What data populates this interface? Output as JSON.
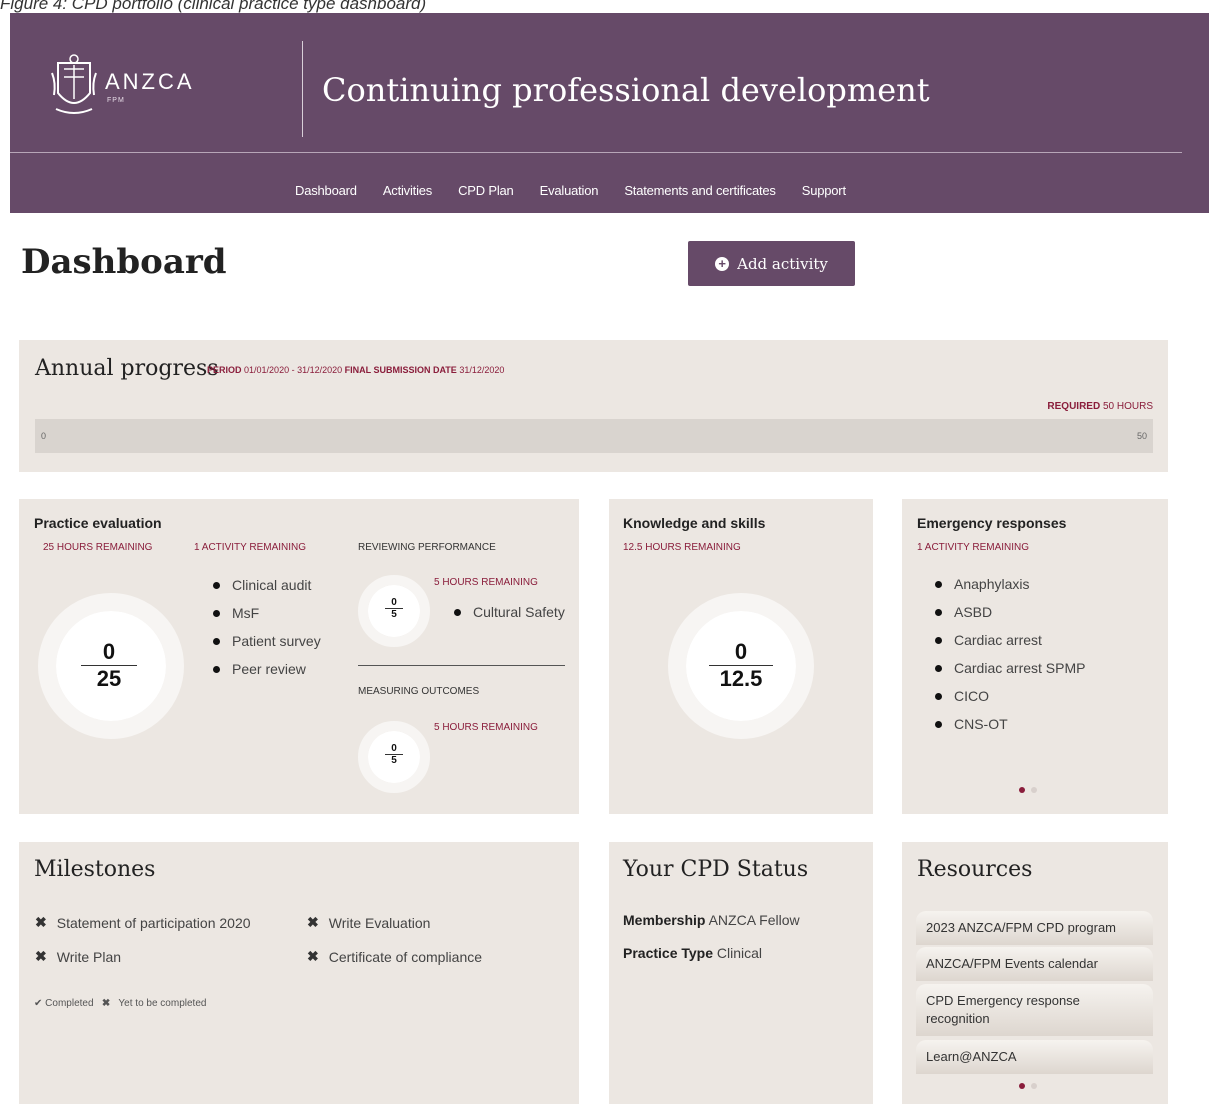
{
  "caption": "Figure 4: CPD portfolio (clinical practice type dashboard)",
  "header": {
    "logo_text": "ANZCA",
    "logo_sub": "FPM",
    "title": "Continuing professional development",
    "color": "#664a68"
  },
  "nav": [
    "Dashboard",
    "Activities",
    "CPD Plan",
    "Evaluation",
    "Statements and certificates",
    "Support"
  ],
  "page_title": "Dashboard",
  "add_button": "Add activity",
  "annual": {
    "title": "Annual progress",
    "period_label": "PERIOD",
    "period": "01/01/2020 - 31/12/2020",
    "submission_label": "FINAL SUBMISSION DATE",
    "submission_date": "31/12/2020",
    "required_label": "REQUIRED",
    "required_value": "50 HOURS",
    "bar_min": "0",
    "bar_max": "50",
    "progress_fraction": 0
  },
  "practice": {
    "title": "Practice evaluation",
    "hours_remaining": "25 HOURS REMAINING",
    "activity_remaining": "1 ACTIVITY REMAINING",
    "done": "0",
    "total": "25",
    "activities": [
      "Clinical audit",
      "MsF",
      "Patient survey",
      "Peer review"
    ],
    "reviewing": {
      "title": "REVIEWING PERFORMANCE",
      "remaining": "5 HOURS REMAINING",
      "done": "0",
      "total": "5",
      "items": [
        "Cultural Safety"
      ]
    },
    "measuring": {
      "title": "MEASURING OUTCOMES",
      "remaining": "5 HOURS REMAINING",
      "done": "0",
      "total": "5"
    }
  },
  "knowledge": {
    "title": "Knowledge and skills",
    "remaining": "12.5 HOURS REMAINING",
    "done": "0",
    "total": "12.5"
  },
  "emergency": {
    "title": "Emergency responses",
    "remaining": "1 ACTIVITY REMAINING",
    "items": [
      "Anaphylaxis",
      "ASBD",
      "Cardiac arrest",
      "Cardiac arrest SPMP",
      "CICO",
      "CNS-OT"
    ]
  },
  "milestones": {
    "title": "Milestones",
    "left": [
      "Statement of participation 2020",
      "Write Plan"
    ],
    "right": [
      "Write Evaluation",
      "Certificate of compliance"
    ],
    "legend_completed": "Completed",
    "legend_yet": "Yet to be completed"
  },
  "cpd_status": {
    "title": "Your CPD Status",
    "membership_label": "Membership",
    "membership_value": "ANZCA Fellow",
    "practice_label": "Practice Type",
    "practice_value": "Clinical"
  },
  "resources": {
    "title": "Resources",
    "items": [
      "2023 ANZCA/FPM CPD program",
      "ANZCA/FPM Events calendar",
      "CPD Emergency response recognition",
      "Learn@ANZCA"
    ]
  },
  "colors": {
    "accent": "#8a1d3b",
    "panel": "#ece7e2",
    "dot_active": "#8a1d3b",
    "dot_inactive": "#d8d0cc"
  }
}
